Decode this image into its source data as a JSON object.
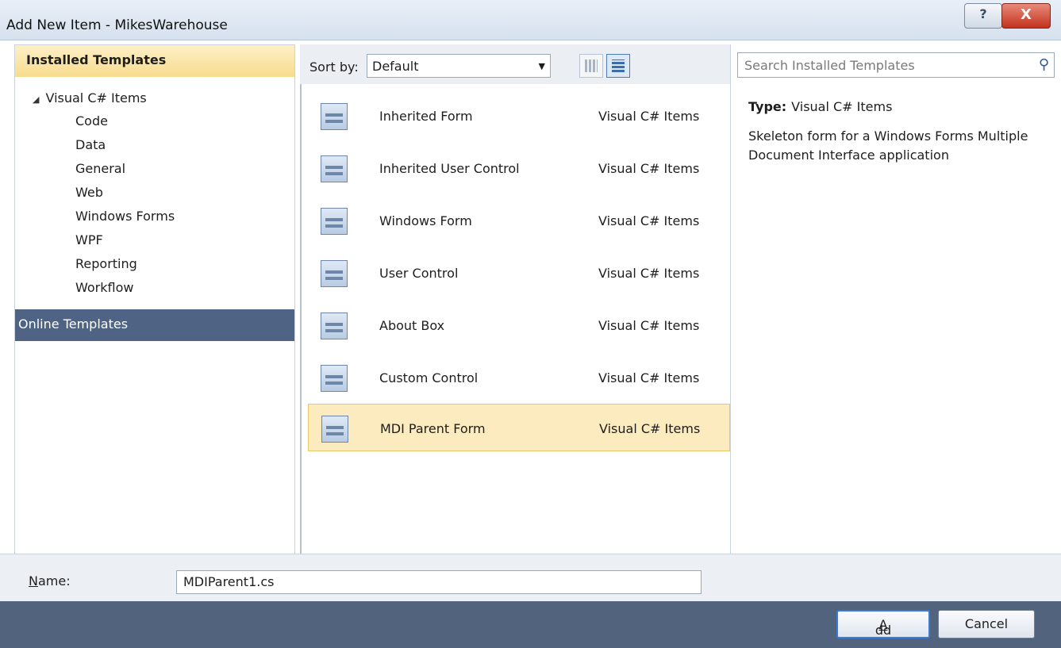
{
  "window": {
    "title": "Add New Item - MikesWarehouse",
    "help_glyph": "?",
    "close_glyph": "X"
  },
  "left": {
    "header": "Installed Templates",
    "root": "Visual C# Items",
    "items": [
      "Code",
      "Data",
      "General",
      "Web",
      "Windows Forms",
      "WPF",
      "Reporting",
      "Workflow"
    ],
    "online": "Online Templates"
  },
  "toolbar": {
    "sort_label": "Sort by:",
    "sort_value": "Default"
  },
  "templates": [
    {
      "name": "Inherited Form",
      "category": "Visual C# Items",
      "icon": "inherited-form-icon"
    },
    {
      "name": "Inherited User Control",
      "category": "Visual C# Items",
      "icon": "inherited-user-control-icon"
    },
    {
      "name": "Windows Form",
      "category": "Visual C# Items",
      "icon": "windows-form-icon"
    },
    {
      "name": "User Control",
      "category": "Visual C# Items",
      "icon": "user-control-icon"
    },
    {
      "name": "About Box",
      "category": "Visual C# Items",
      "icon": "about-box-icon"
    },
    {
      "name": "Custom Control",
      "category": "Visual C# Items",
      "icon": "custom-control-icon"
    },
    {
      "name": "MDI Parent Form",
      "category": "Visual C# Items",
      "icon": "mdi-parent-form-icon",
      "selected": true
    }
  ],
  "details": {
    "search_placeholder": "Search Installed Templates",
    "type_label": "Type:",
    "type_value": "Visual C# Items",
    "description": "Skeleton form for a Windows Forms Multiple Document Interface application"
  },
  "name_field": {
    "label_first": "N",
    "label_rest": "ame:",
    "value": "MDIParent1.cs"
  },
  "buttons": {
    "add_first": "A",
    "add_rest": "dd",
    "cancel": "Cancel"
  },
  "colors": {
    "selection": "#fbebbf",
    "online_bg": "#4f6384",
    "footer_bg": "#52637d"
  }
}
